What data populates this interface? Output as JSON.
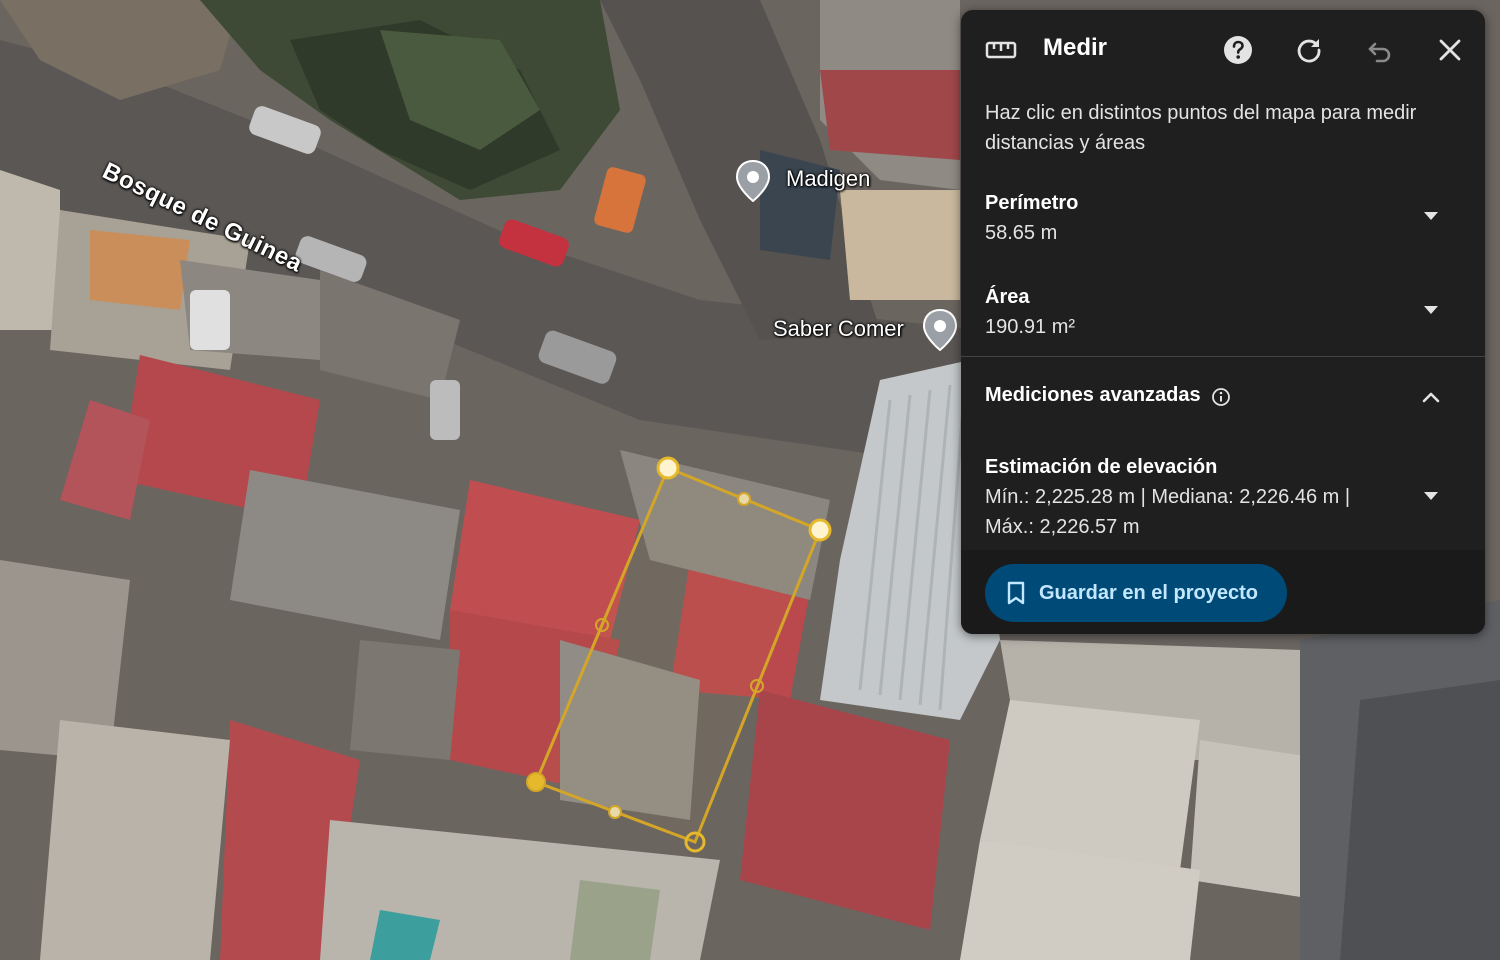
{
  "map": {
    "street_label": "Bosque de Guinea",
    "pois": [
      {
        "name": "Madigen"
      },
      {
        "name": "Saber Comer"
      }
    ],
    "measurement_color": "#f2c94c"
  },
  "panel": {
    "icon": "ruler-icon",
    "title": "Medir",
    "instructions": "Haz clic en distintos puntos del mapa para medir distancias y áreas",
    "perimeter": {
      "label": "Perímetro",
      "value": "58.65 m"
    },
    "area": {
      "label": "Área",
      "value": "190.91 m²"
    },
    "advanced": {
      "label": "Mediciones avanzadas"
    },
    "elevation": {
      "label": "Estimación de elevación",
      "line1": "Mín.: 2,225.28 m | Mediana: 2,226.46 m |",
      "line2": "Máx.: 2,226.57 m"
    },
    "save_button": "Guardar en el proyecto",
    "colors": {
      "background": "#1f1f1f",
      "button": "#004a77",
      "button_text": "#c2e7ff"
    }
  }
}
